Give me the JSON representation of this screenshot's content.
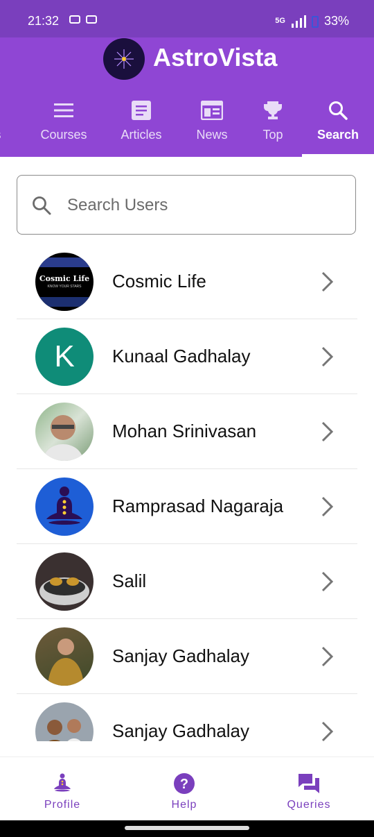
{
  "status": {
    "time": "21:32",
    "network": "5G",
    "battery": "33%"
  },
  "app": {
    "title": "AstroVista",
    "logo_icon": "astro-star-icon"
  },
  "tabs": [
    {
      "label": "s",
      "icon": "partial-icon"
    },
    {
      "label": "Courses",
      "icon": "menu-icon"
    },
    {
      "label": "Articles",
      "icon": "article-icon"
    },
    {
      "label": "News",
      "icon": "news-icon"
    },
    {
      "label": "Top",
      "icon": "trophy-icon"
    },
    {
      "label": "Search",
      "icon": "search-icon",
      "active": true
    }
  ],
  "search": {
    "placeholder": "Search Users",
    "value": ""
  },
  "users": [
    {
      "name": "Cosmic Life",
      "avatar_text": "Cosmic Life",
      "avatar_sub": "KNOW YOUR STARS",
      "avatar_kind": "logo"
    },
    {
      "name": "Kunaal Gadhalay",
      "avatar_text": "K",
      "avatar_kind": "initial",
      "avatar_color": "#0f8c78"
    },
    {
      "name": "Mohan Srinivasan",
      "avatar_kind": "photo"
    },
    {
      "name": "Ramprasad Nagaraja",
      "avatar_kind": "meditation",
      "avatar_color": "#1e5ed6"
    },
    {
      "name": "Salil",
      "avatar_kind": "photo"
    },
    {
      "name": "Sanjay Gadhalay",
      "avatar_kind": "photo"
    },
    {
      "name": "Sanjay Gadhalay",
      "avatar_kind": "photo"
    }
  ],
  "bottom_nav": [
    {
      "label": "Profile",
      "icon": "meditation-icon"
    },
    {
      "label": "Help",
      "icon": "help-icon"
    },
    {
      "label": "Queries",
      "icon": "chat-icon"
    }
  ],
  "colors": {
    "primary": "#8f46d4",
    "status_bar": "#7a3fbd",
    "accent_text": "#7a3fbd"
  }
}
